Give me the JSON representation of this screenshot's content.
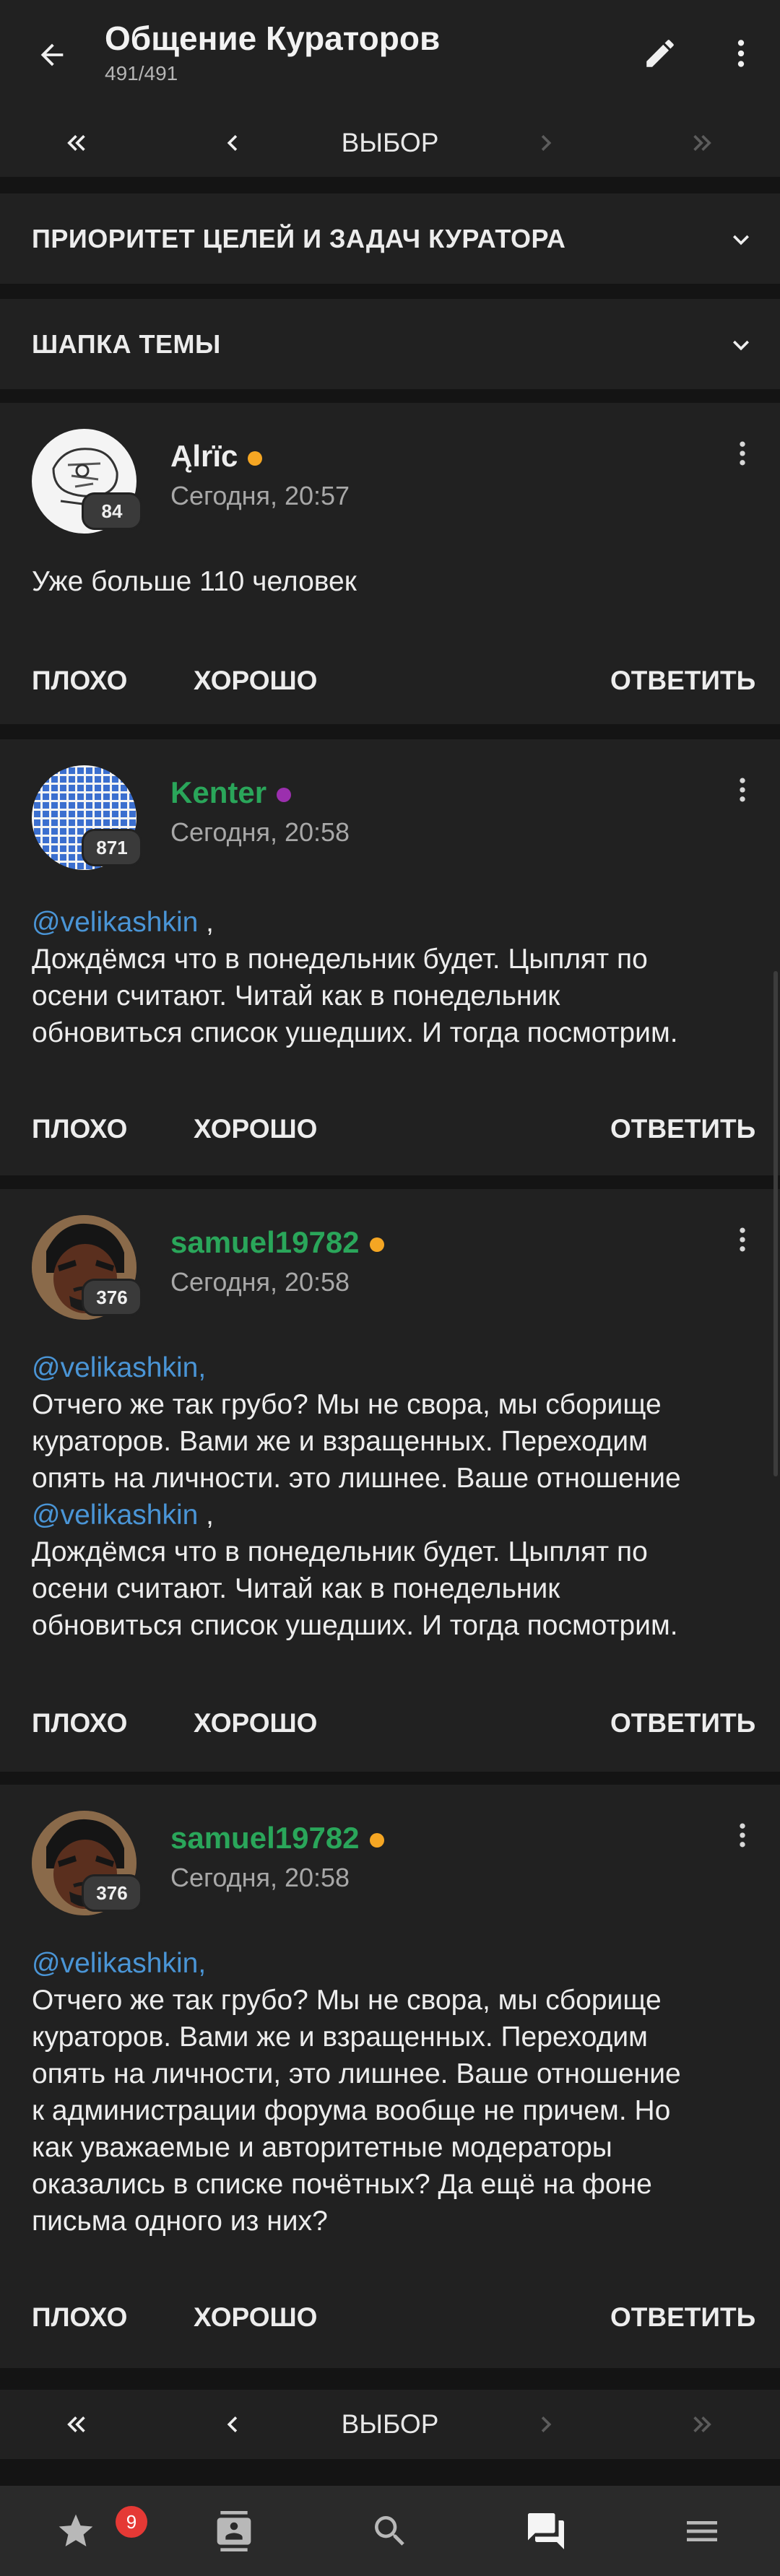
{
  "topbar": {
    "title": "Общение Кураторов",
    "subtitle": "491/491",
    "icons": [
      "arrow-back-icon",
      "pencil-icon",
      "more-vert-icon"
    ]
  },
  "pager": {
    "label": "ВЫБОР",
    "icons": [
      "first-page-icon",
      "prev-page-icon",
      "next-page-icon",
      "last-page-icon"
    ]
  },
  "sections": [
    {
      "title": "ПРИОРИТЕТ ЦЕЛЕЙ И ЗАДАЧ КУРАТОРА"
    },
    {
      "title": "ШАПКА ТЕМЫ"
    }
  ],
  "actions": {
    "bad": "ПЛОХО",
    "good": "ХОРОШО",
    "reply": "ОТВЕТИТЬ"
  },
  "colors": {
    "background": "#141414",
    "card": "#212121",
    "mention": "#4a95d6",
    "username_green": "#2aa65a",
    "online_orange": "#f5a623",
    "online_purple": "#9b2fae",
    "badge_red": "#e53935"
  },
  "posts": [
    {
      "author": "Ąlrïc",
      "author_color": "#eeeeee",
      "status_color": "#f5a623",
      "reputation": "84",
      "time": "Сегодня, 20:57",
      "lines": [
        {
          "text": "Уже больше 110 человек"
        }
      ]
    },
    {
      "author": "Kenter",
      "author_color": "#2aa65a",
      "status_color": "#9b2fae",
      "reputation": "871",
      "time": "Сегодня, 20:58",
      "lines": [
        {
          "mention": "@velikashkin",
          "text": " ,"
        },
        {
          "text": "Дождёмся что в понедельник будет. Цыплят по"
        },
        {
          "text": "осени считают. Читай как в понедельник"
        },
        {
          "text": "обновиться список ушедших. И тогда посмотрим."
        }
      ]
    },
    {
      "author": "samuel19782",
      "author_color": "#2aa65a",
      "status_color": "#f5a623",
      "reputation": "376",
      "time": "Сегодня, 20:58",
      "lines": [
        {
          "mention": "@velikashkin,",
          "text": ""
        },
        {
          "text": "Отчего же так грубо? Мы не свора, мы сборище"
        },
        {
          "text": "кураторов. Вами же и взращенных. Переходим"
        },
        {
          "text": "опять на личности. это лишнее. Ваше отношение"
        },
        {
          "mention": "@velikashkin",
          "text": " ,"
        },
        {
          "text": "Дождёмся что в понедельник будет. Цыплят по"
        },
        {
          "text": "осени считают. Читай как в понедельник"
        },
        {
          "text": "обновиться список ушедших. И тогда посмотрим."
        }
      ]
    },
    {
      "author": "samuel19782",
      "author_color": "#2aa65a",
      "status_color": "#f5a623",
      "reputation": "376",
      "time": "Сегодня, 20:58",
      "lines": [
        {
          "mention": "@velikashkin,",
          "text": ""
        },
        {
          "text": "Отчего же так грубо? Мы не свора, мы сборище"
        },
        {
          "text": "кураторов. Вами же и взращенных. Переходим"
        },
        {
          "text": "опять на личности, это лишнее. Ваше отношение"
        },
        {
          "text": "к администрации форума вообще не причем. Но"
        },
        {
          "text": "как уважаемые и авторитетные модераторы"
        },
        {
          "text": "оказались в списке почётных? Да ещё на фоне"
        },
        {
          "text": "письма одного из них?"
        }
      ]
    }
  ],
  "bottomnav": {
    "notification_count": "9",
    "icons": [
      "star-icon",
      "contacts-icon",
      "search-icon",
      "forum-icon",
      "menu-icon"
    ]
  }
}
